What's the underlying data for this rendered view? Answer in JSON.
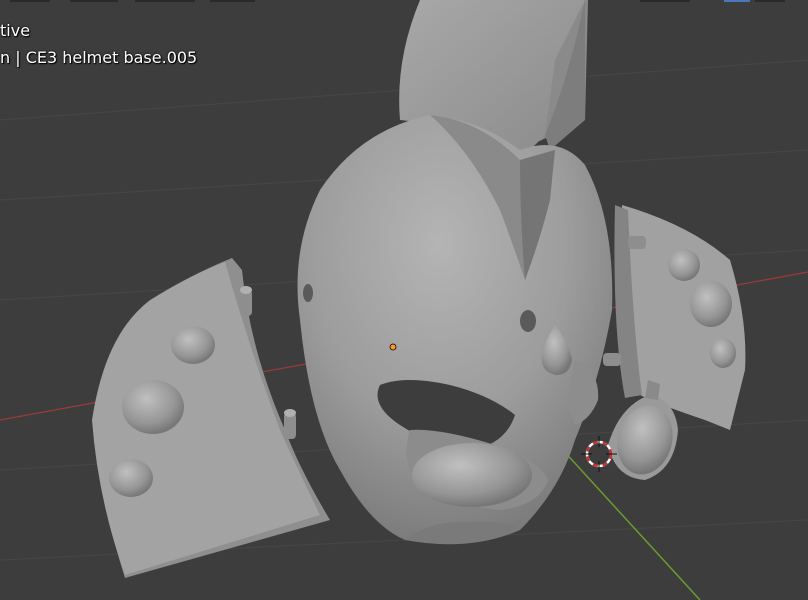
{
  "viewport": {
    "mode_text": "tive",
    "object_text": "n | CE3 helmet base.005",
    "background": "#3d3d3d",
    "x_axis_color": "#9a3a3a",
    "y_axis_color": "#6e9a2e",
    "mesh_color": "#9c9c9c",
    "origin_color": "#ff9a2a",
    "cursor_color": "#c43030",
    "icons": [
      "3d-cursor-icon",
      "object-origin-icon"
    ]
  }
}
